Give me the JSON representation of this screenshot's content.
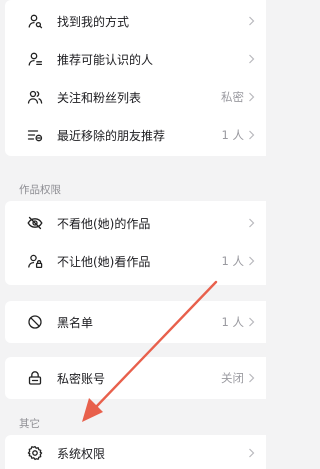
{
  "privacy_card": {
    "items": [
      {
        "label": "找到我的方式",
        "value": "",
        "icon": "person-search-icon"
      },
      {
        "label": "推荐可能认识的人",
        "value": "",
        "icon": "person-recommend-icon"
      },
      {
        "label": "关注和粉丝列表",
        "value": "私密",
        "icon": "people-icon"
      },
      {
        "label": "最近移除的朋友推荐",
        "value": "1 人",
        "icon": "removed-list-icon"
      }
    ]
  },
  "works_section": {
    "title": "作品权限",
    "items": [
      {
        "label": "不看他(她)的作品",
        "value": "",
        "icon": "eye-off-icon"
      },
      {
        "label": "不让他(她)看作品",
        "value": "1 人",
        "icon": "person-lock-icon"
      }
    ]
  },
  "blacklist": {
    "label": "黑名单",
    "value": "1 人",
    "icon": "block-icon"
  },
  "private_account": {
    "label": "私密账号",
    "value": "关闭",
    "icon": "lock-icon"
  },
  "other_section": {
    "title": "其它",
    "items": [
      {
        "label": "系统权限",
        "value": "",
        "icon": "gear-icon"
      }
    ]
  },
  "colors": {
    "background": "#f3f3f4",
    "card": "#ffffff",
    "text": "#1b1b1f",
    "secondary_text": "#9a9aa0",
    "annotation_arrow": "#e8604c"
  }
}
